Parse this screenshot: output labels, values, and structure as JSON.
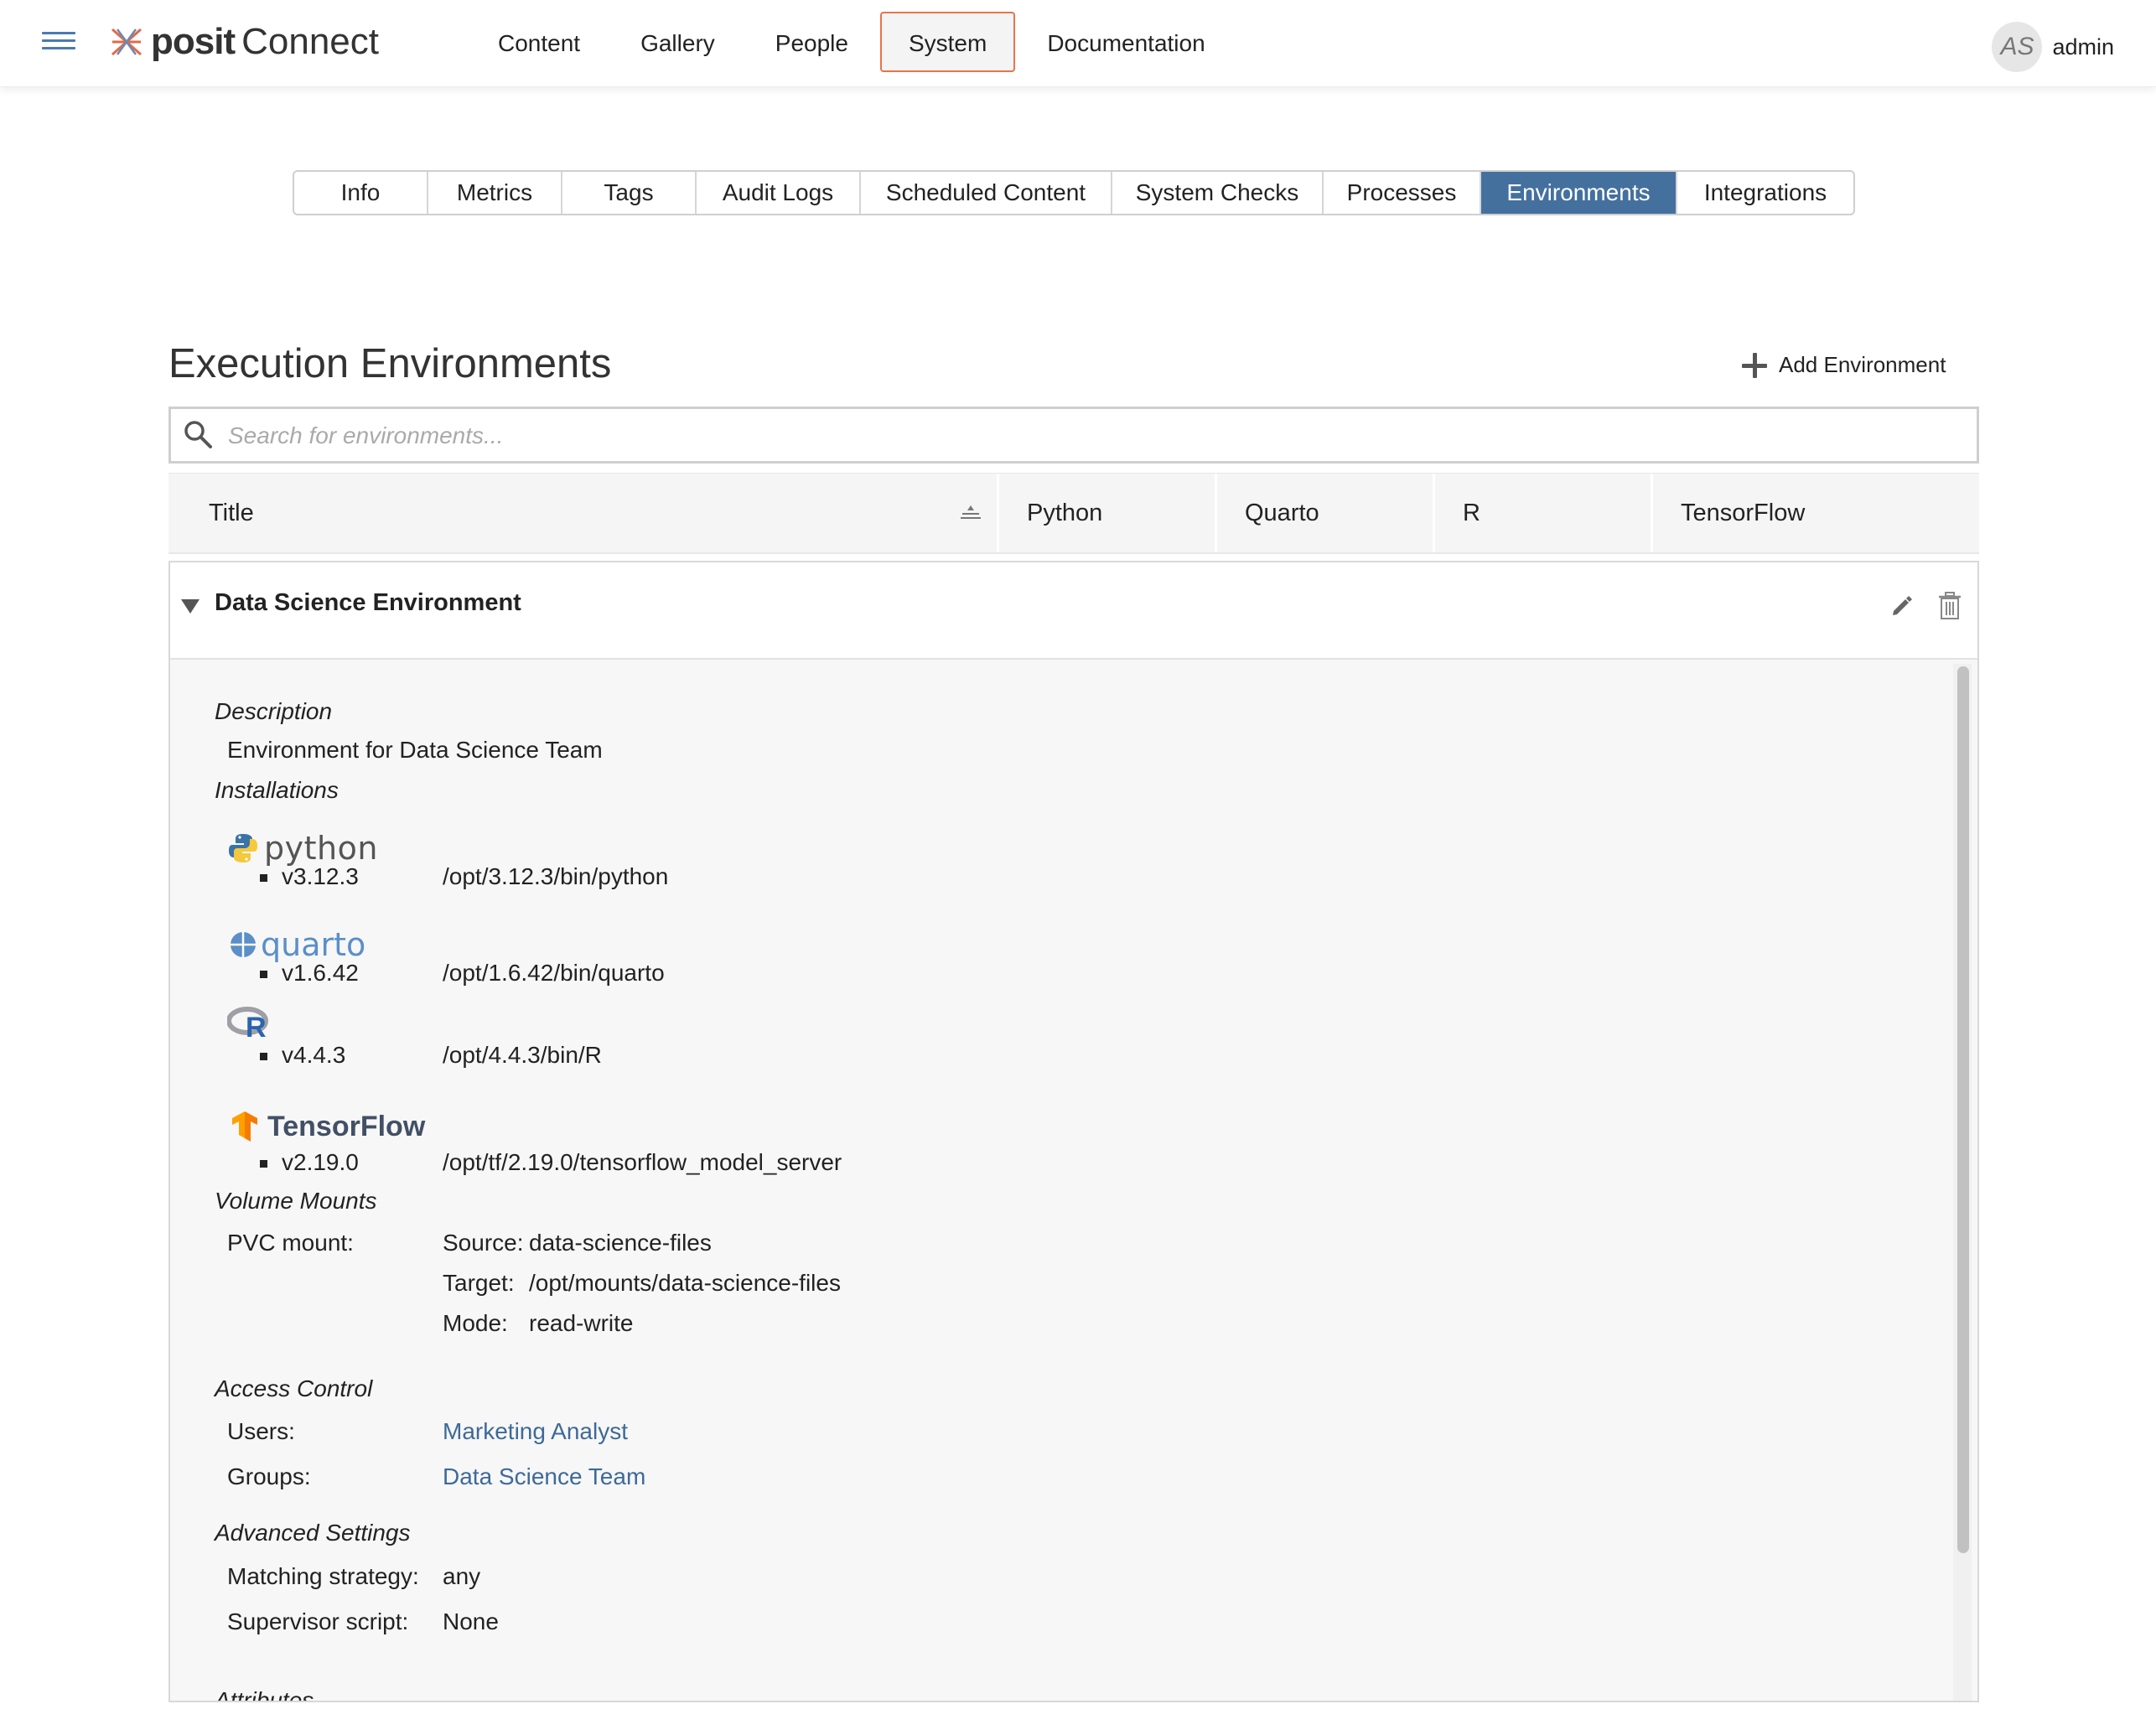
{
  "header": {
    "logo_brand": "posit",
    "logo_product": "Connect",
    "nav": [
      "Content",
      "Gallery",
      "People",
      "System",
      "Documentation"
    ],
    "active_nav": "System",
    "user": {
      "initials": "AS",
      "name": "admin"
    }
  },
  "subtabs": {
    "items": [
      "Info",
      "Metrics",
      "Tags",
      "Audit Logs",
      "Scheduled Content",
      "System Checks",
      "Processes",
      "Environments",
      "Integrations"
    ],
    "active": "Environments"
  },
  "page": {
    "title": "Execution Environments",
    "add_button": "Add Environment",
    "search_placeholder": "Search for environments..."
  },
  "table": {
    "columns": [
      "Title",
      "Python",
      "Quarto",
      "R",
      "TensorFlow"
    ]
  },
  "environment": {
    "title": "Data Science Environment",
    "description_label": "Description",
    "description": "Environment for Data Science Team",
    "installations_label": "Installations",
    "python": {
      "brand": "python",
      "version": "v3.12.3",
      "path": "/opt/3.12.3/bin/python"
    },
    "quarto": {
      "brand": "quarto",
      "version": "v1.6.42",
      "path": "/opt/1.6.42/bin/quarto"
    },
    "r": {
      "version": "v4.4.3",
      "path": "/opt/4.4.3/bin/R"
    },
    "tensorflow": {
      "brand": "TensorFlow",
      "version": "v2.19.0",
      "path": "/opt/tf/2.19.0/tensorflow_model_server"
    },
    "volume_label": "Volume Mounts",
    "volume": {
      "type": "PVC mount:",
      "source_label": "Source:",
      "source": "data-science-files",
      "target_label": "Target:",
      "target": "/opt/mounts/data-science-files",
      "mode_label": "Mode:",
      "mode": "read-write"
    },
    "access_label": "Access Control",
    "access": {
      "users_label": "Users:",
      "users": "Marketing Analyst",
      "groups_label": "Groups:",
      "groups": "Data Science Team"
    },
    "advanced_label": "Advanced Settings",
    "advanced": {
      "matching_label": "Matching strategy:",
      "matching": "any",
      "supervisor_label": "Supervisor script:",
      "supervisor": "None"
    },
    "attributes_label": "Attributes"
  },
  "colors": {
    "accent_blue": "#44709e",
    "link_blue": "#3d6a98",
    "active_nav_border": "#e8734a"
  },
  "icons": [
    "hamburger-icon",
    "posit-logo-icon",
    "plus-icon",
    "search-icon",
    "sort-icon",
    "caret-down-icon",
    "edit-icon",
    "trash-icon",
    "python-logo-icon",
    "quarto-logo-icon",
    "r-logo-icon",
    "tensorflow-logo-icon"
  ]
}
